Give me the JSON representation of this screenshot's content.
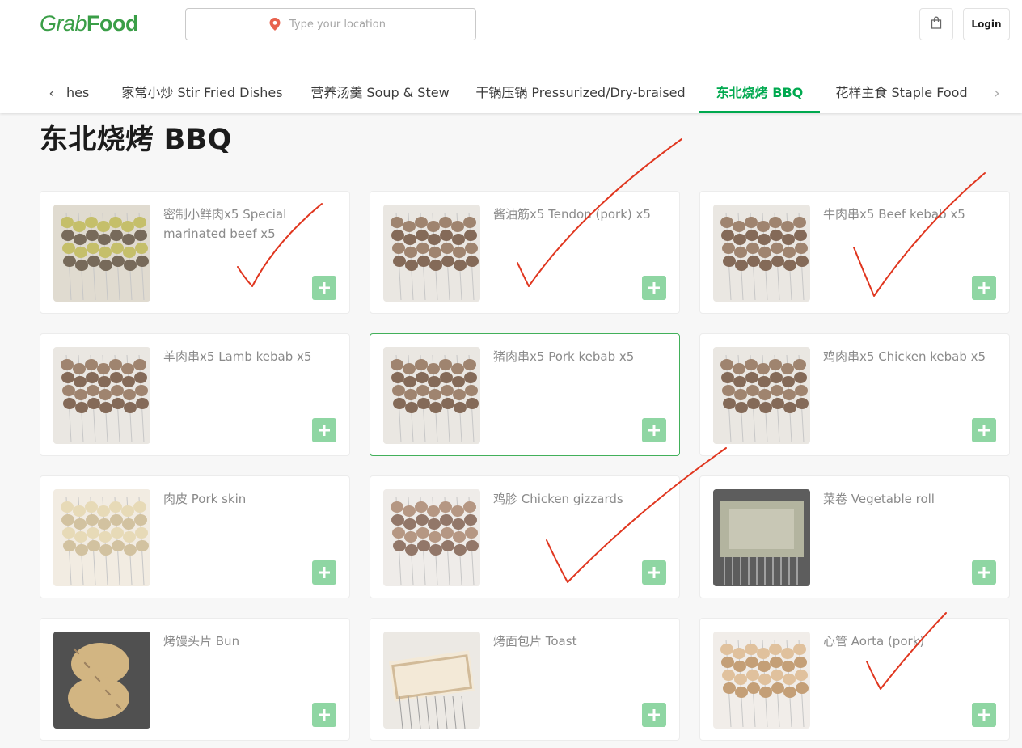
{
  "header": {
    "logo_grab": "Grab",
    "logo_food": "Food",
    "location_placeholder": "Type your location",
    "login_label": "Login"
  },
  "tabs": {
    "partial_left": "hes",
    "items": [
      {
        "label": "家常小炒 Stir Fried Dishes"
      },
      {
        "label": "营养汤羹 Soup & Stew"
      },
      {
        "label": "干锅压锅 Pressurized/Dry-braised"
      },
      {
        "label": "东北烧烤 BBQ"
      },
      {
        "label": "花样主食 Staple Food"
      }
    ],
    "active_index": 3
  },
  "section": {
    "title": "东北烧烤 BBQ"
  },
  "menu_items": [
    {
      "name": "密制小鲜肉x5 Special marinated beef x5",
      "image": "skewers-herbs"
    },
    {
      "name": "酱油筋x5 Tendon (pork) x5",
      "image": "skewers-dark"
    },
    {
      "name": "牛肉串x5 Beef kebab x5",
      "image": "skewers-dark"
    },
    {
      "name": "羊肉串x5 Lamb kebab x5",
      "image": "skewers-dark"
    },
    {
      "name": "猪肉串x5 Pork kebab x5",
      "image": "skewers-dark"
    },
    {
      "name": "鸡肉串x5 Chicken kebab x5",
      "image": "skewers-dark"
    },
    {
      "name": "肉皮 Pork skin",
      "image": "skewers-light"
    },
    {
      "name": "鸡胗 Chicken gizzards",
      "image": "skewers-gizzard"
    },
    {
      "name": "菜卷 Vegetable roll",
      "image": "vegetable-roll"
    },
    {
      "name": "烤馒头片 Bun",
      "image": "bun"
    },
    {
      "name": "烤面包片 Toast",
      "image": "toast"
    },
    {
      "name": "心管 Aorta (pork)",
      "image": "skewers-aorta"
    }
  ],
  "colors": {
    "brand_green": "#00a94f",
    "add_button": "#8fd6a3",
    "checkmark_red": "#e0361f"
  },
  "icons": {
    "location": "location-pin-icon",
    "cart": "shopping-bag-icon",
    "add": "plus-icon",
    "prev": "chevron-left-icon",
    "next": "chevron-right-icon"
  }
}
